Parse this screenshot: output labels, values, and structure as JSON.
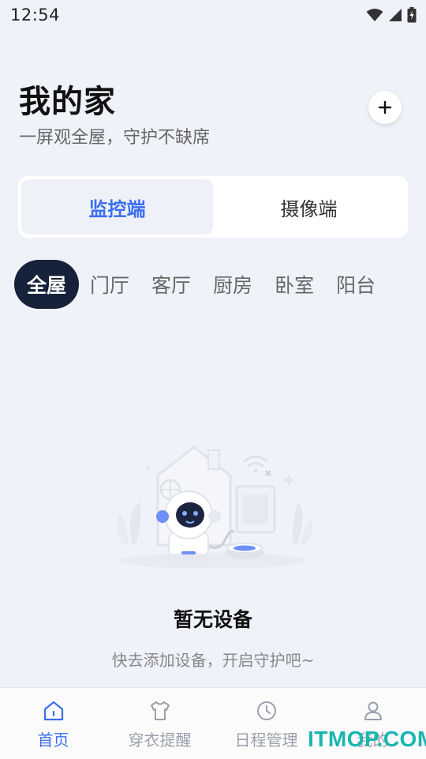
{
  "status_bar": {
    "time": "12:54",
    "icons": [
      "wifi-icon",
      "signal-icon",
      "battery-icon"
    ]
  },
  "header": {
    "title": "我的家",
    "subtitle": "一屏观全屋，守护不缺席",
    "add_icon": "plus-icon"
  },
  "segment": {
    "items": [
      {
        "label": "监控端",
        "active": true
      },
      {
        "label": "摄像端",
        "active": false
      }
    ]
  },
  "rooms": {
    "items": [
      {
        "label": "全屋",
        "active": true
      },
      {
        "label": "门厅",
        "active": false
      },
      {
        "label": "客厅",
        "active": false
      },
      {
        "label": "厨房",
        "active": false
      },
      {
        "label": "卧室",
        "active": false
      },
      {
        "label": "阳台",
        "active": false
      }
    ]
  },
  "empty_state": {
    "illustration": "robot-camera-home-illustration",
    "title": "暂无设备",
    "subtitle": "快去添加设备，开启守护吧~"
  },
  "bottom_nav": {
    "items": [
      {
        "label": "首页",
        "icon": "home-icon",
        "active": true
      },
      {
        "label": "穿衣提醒",
        "icon": "shirt-icon",
        "active": false
      },
      {
        "label": "日程管理",
        "icon": "clock-icon",
        "active": false
      },
      {
        "label": "我的",
        "icon": "user-icon",
        "active": false
      }
    ]
  },
  "watermark": {
    "text": "ITMOP.COM"
  },
  "colors": {
    "accent": "#3b6ef0",
    "dark_pill": "#16213a",
    "background": "#eff2f9"
  }
}
